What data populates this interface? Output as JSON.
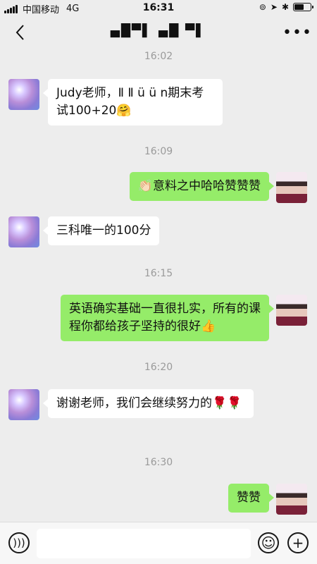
{
  "status_bar": {
    "carrier": "中国移动",
    "network": "4G",
    "time": "16:31",
    "battery_level": 0.6
  },
  "nav": {
    "title": "▄█▀▌ ▄█ ▀▌"
  },
  "messages": [
    {
      "timestamp": "16:02"
    },
    {
      "side": "left",
      "text": "Judy老师，Ⅱ Ⅱ ü ü n期末考试100+20🤗"
    },
    {
      "timestamp": "16:09"
    },
    {
      "side": "right",
      "text": "👏🏻意料之中哈哈赞赞赞"
    },
    {
      "side": "left",
      "text": "三科唯一的100分"
    },
    {
      "timestamp": "16:15"
    },
    {
      "side": "right",
      "text": "英语确实基础一直很扎实，所有的课程你都给孩子坚持的很好👍"
    },
    {
      "timestamp": "16:20"
    },
    {
      "side": "left",
      "text": "谢谢老师，我们会继续努力的🌹🌹"
    },
    {
      "timestamp": "16:30"
    },
    {
      "side": "right",
      "text": "赞赞"
    }
  ],
  "input": {
    "value": "",
    "placeholder": ""
  },
  "icons": {
    "back": "chevron-left-icon",
    "more": "more-dots-icon",
    "voice": "voice-icon",
    "emoji": "emoji-icon",
    "plus": "plus-icon"
  },
  "colors": {
    "background": "#ededed",
    "bubble_right": "#95ec69",
    "bubble_left": "#ffffff",
    "timestamp": "#9a9a9a"
  }
}
